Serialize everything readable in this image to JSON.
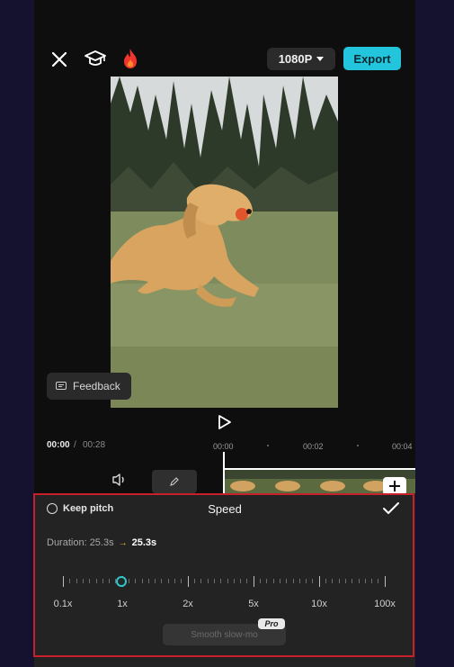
{
  "toolbar": {
    "close_icon": "close-icon",
    "learn_icon": "graduation-cap-icon",
    "fire_icon": "fire-icon",
    "resolution": "1080P",
    "export_label": "Export"
  },
  "preview": {
    "feedback_label": "Feedback"
  },
  "timeline": {
    "current_time": "00:00",
    "separator": "/",
    "total_time": "00:28",
    "ruler": [
      "00:00",
      "00:02",
      "00:04"
    ]
  },
  "speed_panel": {
    "keep_pitch_label": "Keep pitch",
    "title": "Speed",
    "duration_label": "Duration: 25.3s",
    "duration_arrow": "→",
    "duration_new": "25.3s",
    "speed_marks": [
      "0.1x",
      "1x",
      "2x",
      "5x",
      "10x",
      "100x"
    ],
    "current_speed": "1x",
    "smooth_label": "Smooth slow-mo",
    "pro_badge": "Pro"
  },
  "colors": {
    "accent": "#23c5dd",
    "knob": "#34c5c8",
    "highlight_border": "#c8202a"
  }
}
